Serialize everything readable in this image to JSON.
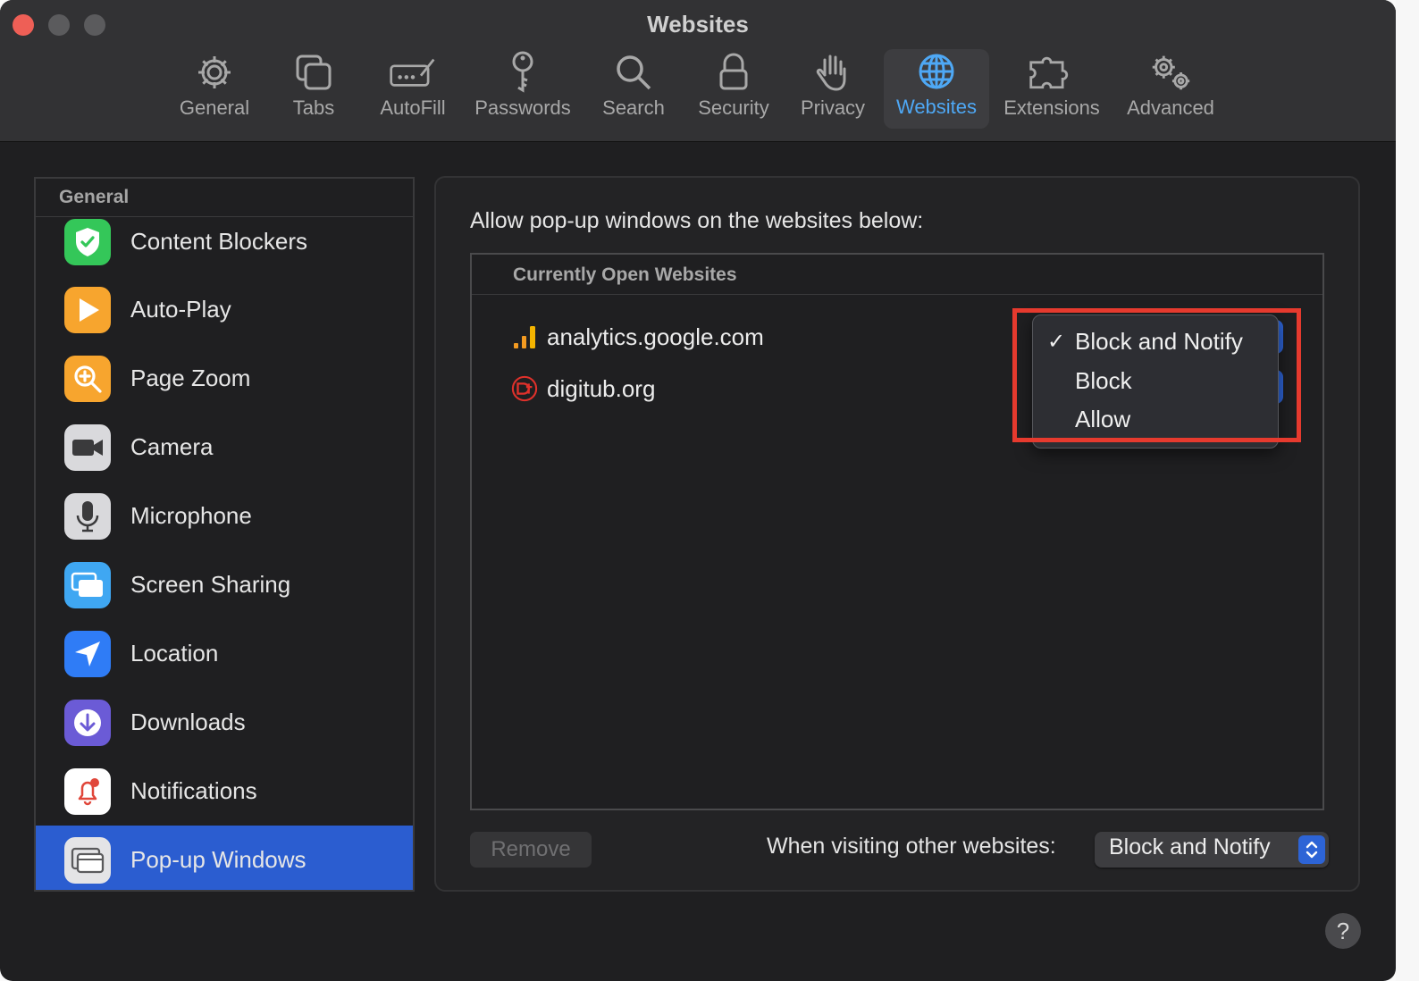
{
  "window": {
    "title": "Websites"
  },
  "toolbar": {
    "items": [
      {
        "label": "General",
        "icon": "gear-icon"
      },
      {
        "label": "Tabs",
        "icon": "tabs-icon"
      },
      {
        "label": "AutoFill",
        "icon": "autofill-icon"
      },
      {
        "label": "Passwords",
        "icon": "key-icon"
      },
      {
        "label": "Search",
        "icon": "magnifier-icon"
      },
      {
        "label": "Security",
        "icon": "lock-icon"
      },
      {
        "label": "Privacy",
        "icon": "hand-icon"
      },
      {
        "label": "Websites",
        "icon": "globe-icon",
        "active": true
      },
      {
        "label": "Extensions",
        "icon": "puzzle-icon"
      },
      {
        "label": "Advanced",
        "icon": "gears-icon"
      }
    ]
  },
  "sidebar": {
    "header": "General",
    "items": [
      {
        "label": "Content Blockers",
        "icon": "shield-check-icon",
        "color": "#34c759"
      },
      {
        "label": "Auto-Play",
        "icon": "play-icon",
        "color": "#f7a52e"
      },
      {
        "label": "Page Zoom",
        "icon": "zoom-icon",
        "color": "#f7a52e"
      },
      {
        "label": "Camera",
        "icon": "camera-icon",
        "color": "#6b6b6e"
      },
      {
        "label": "Microphone",
        "icon": "microphone-icon",
        "color": "#8e8e93"
      },
      {
        "label": "Screen Sharing",
        "icon": "screens-icon",
        "color": "#3fa7f2"
      },
      {
        "label": "Location",
        "icon": "location-arrow-icon",
        "color": "#2f7cf6"
      },
      {
        "label": "Downloads",
        "icon": "download-icon",
        "color": "#6b5bd6"
      },
      {
        "label": "Notifications",
        "icon": "bell-icon",
        "color": "#ffffff"
      },
      {
        "label": "Pop-up Windows",
        "icon": "popup-window-icon",
        "color": "#8e8e93",
        "selected": true
      }
    ]
  },
  "content": {
    "prompt": "Allow pop-up windows on the websites below:",
    "table_header": "Currently Open Websites",
    "sites": [
      {
        "name": "analytics.google.com",
        "icon": "analytics-bars-icon"
      },
      {
        "name": "digitub.org",
        "icon": "digitub-logo-icon"
      }
    ],
    "dropdown": {
      "selected": "Block and Notify",
      "check": "✓",
      "options": [
        "Block and Notify",
        "Block",
        "Allow"
      ]
    },
    "remove_label": "Remove",
    "other_label": "When visiting other websites:",
    "other_value": "Block and Notify",
    "help": "?"
  },
  "colors": {
    "accent": "#2b5dd0",
    "highlight": "#e63a2e",
    "active_tab": "#4ea8f5"
  }
}
